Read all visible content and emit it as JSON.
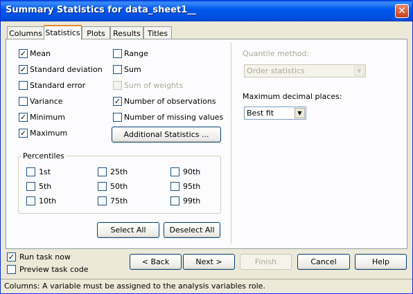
{
  "window": {
    "title": "Summary Statistics for data_sheet1__"
  },
  "tabs": [
    {
      "label": "Columns",
      "active": false
    },
    {
      "label": "Statistics",
      "active": true
    },
    {
      "label": "Plots",
      "active": false
    },
    {
      "label": "Results",
      "active": false
    },
    {
      "label": "Titles",
      "active": false
    }
  ],
  "stats_left": [
    {
      "label": "Mean",
      "checked": true
    },
    {
      "label": "Standard deviation",
      "checked": true
    },
    {
      "label": "Standard error",
      "checked": false
    },
    {
      "label": "Variance",
      "checked": false
    },
    {
      "label": "Minimum",
      "checked": true
    },
    {
      "label": "Maximum",
      "checked": true
    }
  ],
  "stats_right": [
    {
      "label": "Range",
      "checked": false,
      "enabled": true
    },
    {
      "label": "Sum",
      "checked": false,
      "enabled": true
    },
    {
      "label": "Sum of weights",
      "checked": false,
      "enabled": false
    },
    {
      "label": "Number of observations",
      "checked": true,
      "enabled": true
    },
    {
      "label": "Number of missing values",
      "checked": false,
      "enabled": true
    }
  ],
  "additional_stats_label": "Additional Statistics ...",
  "percentiles": {
    "title": "Percentiles",
    "items": [
      "1st",
      "25th",
      "90th",
      "5th",
      "50th",
      "95th",
      "10th",
      "75th",
      "99th"
    ]
  },
  "select_all_label": "Select All",
  "deselect_all_label": "Deselect All",
  "quantile": {
    "label": "Quantile method:",
    "value": "Order statistics"
  },
  "decimal": {
    "label": "Maximum decimal places:",
    "value": "Best fit"
  },
  "run_task": {
    "label": "Run task now",
    "checked": true
  },
  "preview": {
    "label": "Preview task code",
    "checked": false
  },
  "buttons": {
    "back": "< Back",
    "next": "Next >",
    "finish": "Finish",
    "cancel": "Cancel",
    "help": "Help"
  },
  "status": "Columns: A variable must be assigned to the analysis variables role."
}
